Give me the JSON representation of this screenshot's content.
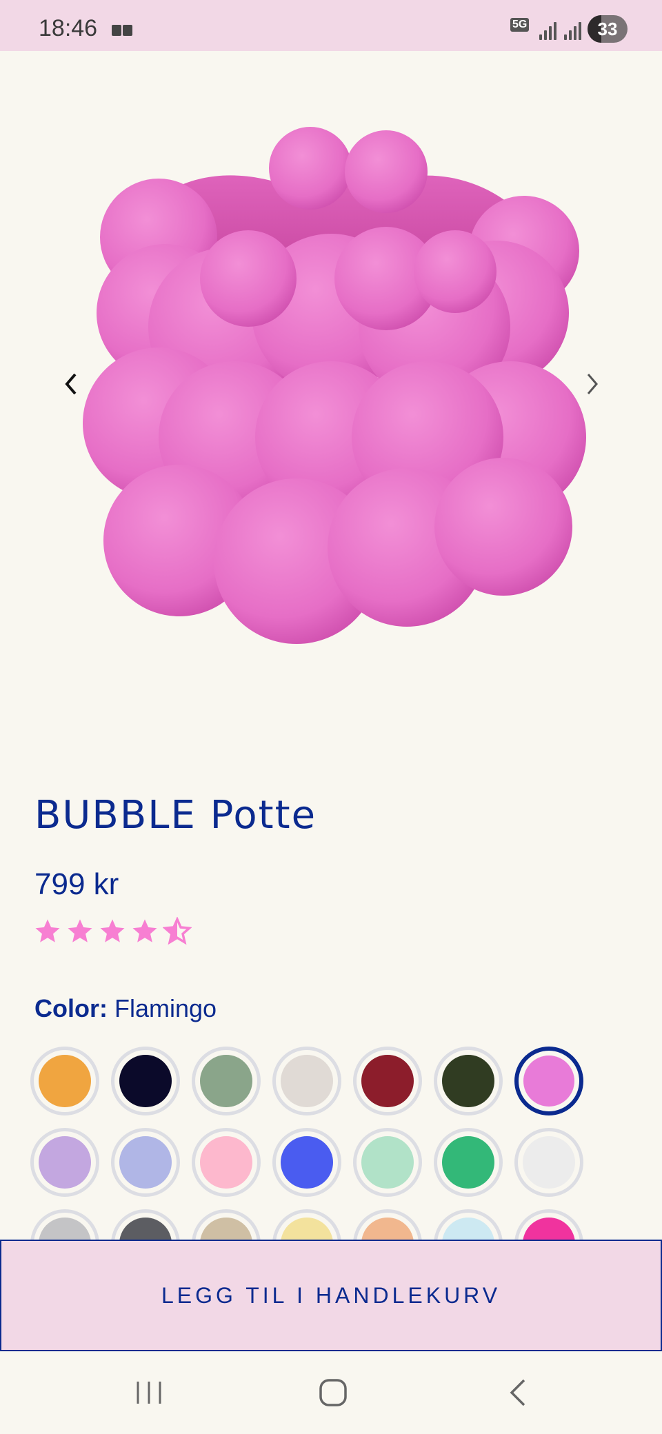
{
  "status_bar": {
    "time": "18:46",
    "network": "5G",
    "battery": "33",
    "signal_icon": "signal-icon",
    "notification_icon": "notification-icon"
  },
  "product": {
    "name": "BUBBLE Potte",
    "price": "799 kr",
    "rating": 4.5,
    "rating_max": 5,
    "image_color": "#e86fc6",
    "color_label": "Color:",
    "color_value": "Flamingo"
  },
  "swatches": [
    {
      "hex": "#f0a540"
    },
    {
      "hex": "#0b0a2a"
    },
    {
      "hex": "#8aa58a"
    },
    {
      "hex": "#e0dad5"
    },
    {
      "hex": "#8c1d2b"
    },
    {
      "hex": "#303c22"
    },
    {
      "hex": "#e87bd8",
      "selected": true
    },
    {
      "hex": "#c3a7e0"
    },
    {
      "hex": "#b0b6e6"
    },
    {
      "hex": "#fdb8cd"
    },
    {
      "hex": "#4a5cf0"
    },
    {
      "hex": "#b1e2c8"
    },
    {
      "hex": "#33b878"
    },
    {
      "hex": "#ececec"
    },
    {
      "hex": "#c4c4c6"
    },
    {
      "hex": "#5c5d62"
    },
    {
      "hex": "#cfbfa4"
    },
    {
      "hex": "#f3e29d"
    },
    {
      "hex": "#f1b78e"
    },
    {
      "hex": "#cde9f2"
    },
    {
      "hex": "#f0339e"
    }
  ],
  "actions": {
    "add_to_cart": "LEGG TIL I HANDLEKURV"
  },
  "colors": {
    "brand_blue": "#0b2a8f",
    "background": "#f9f7f0",
    "accent_pink": "#f2d8e6",
    "star_pink": "#f77fd2"
  },
  "icons": {
    "prev": "chevron-left-icon",
    "next": "chevron-right-icon",
    "nav_recents": "recents-icon",
    "nav_home": "home-icon",
    "nav_back": "back-icon"
  }
}
